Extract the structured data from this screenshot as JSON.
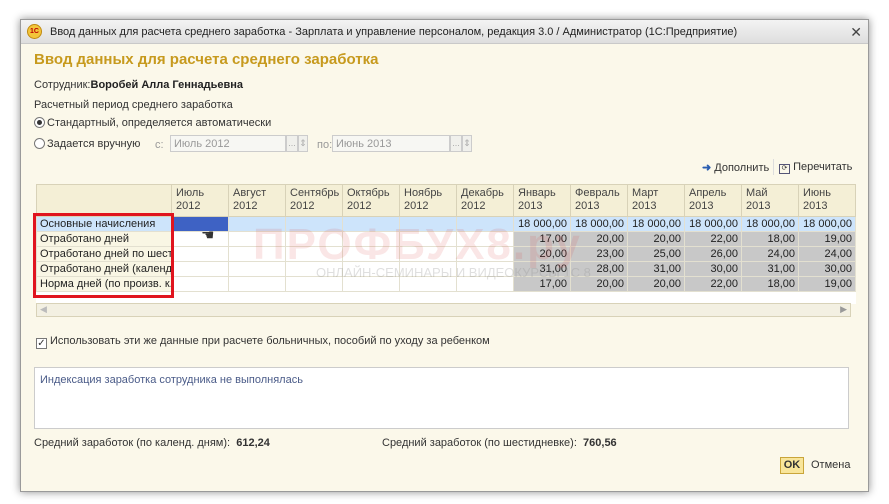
{
  "window": {
    "title": "Ввод данных для расчета среднего заработка - Зарплата и управление персоналом, редакция 3.0 / Администратор  (1С:Предприятие)",
    "logo": "1С"
  },
  "heading": "Ввод данных для расчета среднего заработка",
  "employee": {
    "label": "Сотрудник:",
    "name": "Воробей Алла Геннадьевна"
  },
  "period": {
    "label": "Расчетный период среднего заработка",
    "standard": "Стандартный, определяется автоматически",
    "manual": "Задается вручную",
    "from_label": "с:",
    "from_value": "Июль 2012",
    "to_label": "по:",
    "to_value": "Июнь 2013",
    "selected": "standard"
  },
  "toolbar": {
    "fill": "Дополнить",
    "reread": "Перечитать"
  },
  "table": {
    "months": [
      [
        "Июль",
        "2012"
      ],
      [
        "Август",
        "2012"
      ],
      [
        "Сентябрь",
        "2012"
      ],
      [
        "Октябрь",
        "2012"
      ],
      [
        "Ноябрь",
        "2012"
      ],
      [
        "Декабрь",
        "2012"
      ],
      [
        "Январь",
        "2013"
      ],
      [
        "Февраль",
        "2013"
      ],
      [
        "Март",
        "2013"
      ],
      [
        "Апрель",
        "2013"
      ],
      [
        "Май",
        "2013"
      ],
      [
        "Июнь",
        "2013"
      ]
    ],
    "rows": [
      {
        "label": "Основные начисления",
        "values": [
          "",
          "",
          "",
          "",
          "",
          "",
          "18 000,00",
          "18 000,00",
          "18 000,00",
          "18 000,00",
          "18 000,00",
          "18 000,00"
        ]
      },
      {
        "label": "Отработано дней",
        "values": [
          "",
          "",
          "",
          "",
          "",
          "",
          "17,00",
          "20,00",
          "20,00",
          "22,00",
          "18,00",
          "19,00"
        ]
      },
      {
        "label": "Отработано дней по шест...",
        "values": [
          "",
          "",
          "",
          "",
          "",
          "",
          "20,00",
          "23,00",
          "25,00",
          "26,00",
          "24,00",
          "24,00"
        ]
      },
      {
        "label": "Отработано дней (календ.)",
        "values": [
          "",
          "",
          "",
          "",
          "",
          "",
          "31,00",
          "28,00",
          "31,00",
          "30,00",
          "31,00",
          "30,00"
        ]
      },
      {
        "label": "Норма дней (по произв. к...",
        "values": [
          "",
          "",
          "",
          "",
          "",
          "",
          "17,00",
          "20,00",
          "20,00",
          "22,00",
          "18,00",
          "19,00"
        ]
      }
    ]
  },
  "use_for_sick": {
    "label": "Использовать эти же данные при расчете больничных, пособий по уходу за ребенком",
    "checked": true
  },
  "indexation_note": "Индексация заработка сотрудника не выполнялась",
  "avg_calendar": {
    "label": "Средний заработок (по календ. дням):",
    "value": "612,24"
  },
  "avg_six": {
    "label": "Средний заработок (по шестидневке):",
    "value": "760,56"
  },
  "buttons": {
    "ok": "OK",
    "cancel": "Отмена"
  },
  "watermark": {
    "main": "ПРОФБУХ8.ру",
    "sub": "ОНЛАЙН-СЕМИНАРЫ И ВИДЕОКУРСЫ 1С 8"
  }
}
